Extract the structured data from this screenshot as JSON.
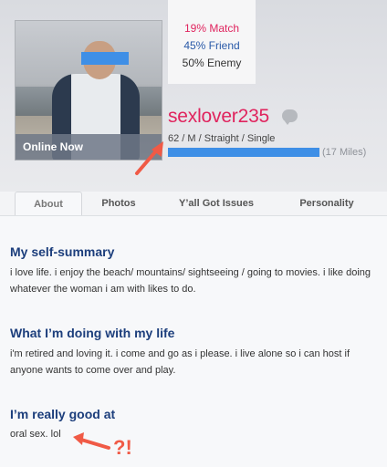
{
  "profile": {
    "photo_badge": "Online Now",
    "username": "sexlover235",
    "details": "62 / M / Straight / Single",
    "distance": "(17 Miles)",
    "chat_icon": "chat-bubble-icon"
  },
  "match_stats": {
    "match": "19% Match",
    "friend": "45% Friend",
    "enemy": "50% Enemy"
  },
  "tabs": [
    {
      "label": "About",
      "active": true
    },
    {
      "label": "Photos",
      "active": false
    },
    {
      "label": "Y’all Got Issues",
      "active": false
    },
    {
      "label": "Personality",
      "active": false
    }
  ],
  "sections": [
    {
      "title": "My self-summary",
      "text": "i love life. i enjoy the beach/ mountains/ sightseeing / going to movies. i like doing whatever the woman i am with likes to do."
    },
    {
      "title": "What I’m doing with my life",
      "text": "i'm retired and loving it. i come and go as i please. i live alone so i can host if anyone wants to come over and play."
    },
    {
      "title": "I’m really good at",
      "text": "oral sex. lol"
    }
  ],
  "annotation": {
    "exclaim": "?!",
    "color": "#f05a46"
  },
  "colors": {
    "username": "#e0245e",
    "section_title": "#1c3e7c",
    "distance_bar": "#3e8fe6"
  }
}
